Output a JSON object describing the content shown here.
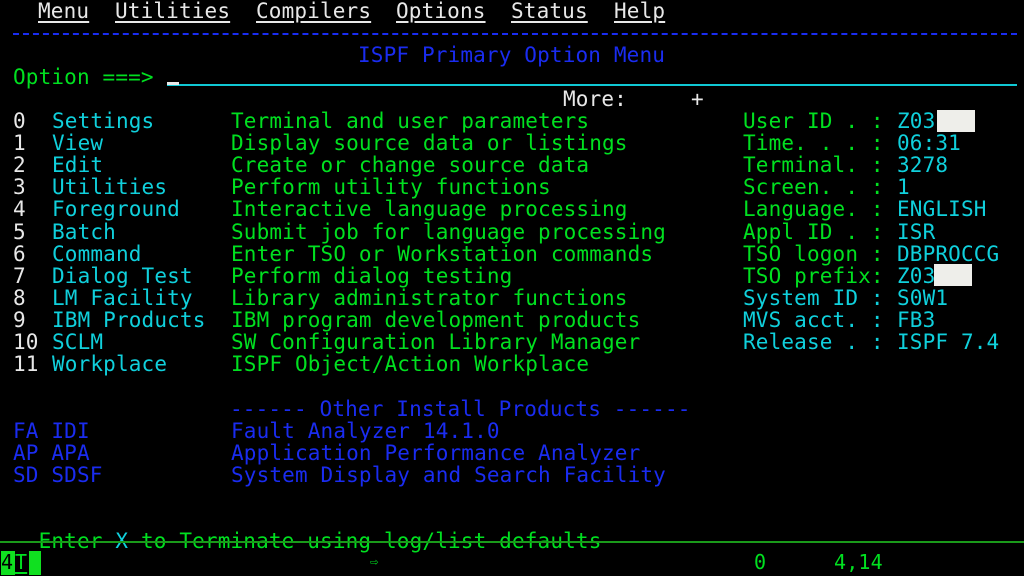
{
  "menubar": [
    {
      "label": "Menu",
      "hotkey": "M"
    },
    {
      "label": "Utilities",
      "hotkey": "U"
    },
    {
      "label": "Compilers",
      "hotkey": "C"
    },
    {
      "label": "Options",
      "hotkey": "O"
    },
    {
      "label": "Status",
      "hotkey": "S"
    },
    {
      "label": "Help",
      "hotkey": "H"
    }
  ],
  "title": "ISPF Primary Option Menu",
  "option_prompt": "Option ===>",
  "option_value": "",
  "more_label": "More:",
  "more_indicator": "+",
  "options": [
    {
      "num": "0",
      "name": "Settings",
      "desc": "Terminal and user parameters"
    },
    {
      "num": "1",
      "name": "View",
      "desc": "Display source data or listings"
    },
    {
      "num": "2",
      "name": "Edit",
      "desc": "Create or change source data"
    },
    {
      "num": "3",
      "name": "Utilities",
      "desc": "Perform utility functions"
    },
    {
      "num": "4",
      "name": "Foreground",
      "desc": "Interactive language processing"
    },
    {
      "num": "5",
      "name": "Batch",
      "desc": "Submit job for language processing"
    },
    {
      "num": "6",
      "name": "Command",
      "desc": "Enter TSO or Workstation commands"
    },
    {
      "num": "7",
      "name": "Dialog Test",
      "desc": "Perform dialog testing"
    },
    {
      "num": "8",
      "name": "LM Facility",
      "desc": "Library administrator functions"
    },
    {
      "num": "9",
      "name": "IBM Products",
      "desc": "IBM program development products"
    },
    {
      "num": "10",
      "name": "SCLM",
      "desc": "SW Configuration Library Manager"
    },
    {
      "num": "11",
      "name": "Workplace",
      "desc": "ISPF Object/Action Workplace"
    }
  ],
  "info": [
    {
      "label": "User ID . :",
      "value": "Z03"
    },
    {
      "label": "Time. . . :",
      "value": "06:31"
    },
    {
      "label": "Terminal. :",
      "value": "3278"
    },
    {
      "label": "Screen. . :",
      "value": "1"
    },
    {
      "label": "Language. :",
      "value": "ENGLISH"
    },
    {
      "label": "Appl ID . :",
      "value": "ISR"
    },
    {
      "label": "TSO logon :",
      "value": "DBPROCCG"
    },
    {
      "label": "TSO prefix:",
      "value": "Z03"
    },
    {
      "label": "System ID :",
      "value": "S0W1"
    },
    {
      "label": "MVS acct. :",
      "value": "FB3"
    },
    {
      "label": "Release . :",
      "value": "ISPF 7.4"
    }
  ],
  "other_header": "------ Other Install Products ------",
  "other_products": [
    {
      "code": "FA IDI",
      "desc": "Fault Analyzer 14.1.0"
    },
    {
      "code": "AP APA",
      "desc": "Application Performance Analyzer"
    },
    {
      "code": "SD SDSF",
      "desc": "System Display and Search Facility"
    }
  ],
  "terminate": {
    "pre": "Enter ",
    "key": "X",
    "post": " to Terminate using log/list defaults"
  },
  "status_bar": {
    "oia_left_a": "4",
    "oia_left_b": "T",
    "arrow": "⇨",
    "msg_count": "0",
    "cursor_pos": "4,14"
  },
  "colors": {
    "green": "#00e020",
    "cyan": "#10d0dc",
    "blue": "#1a2cf0",
    "white": "#e8e8e8"
  }
}
